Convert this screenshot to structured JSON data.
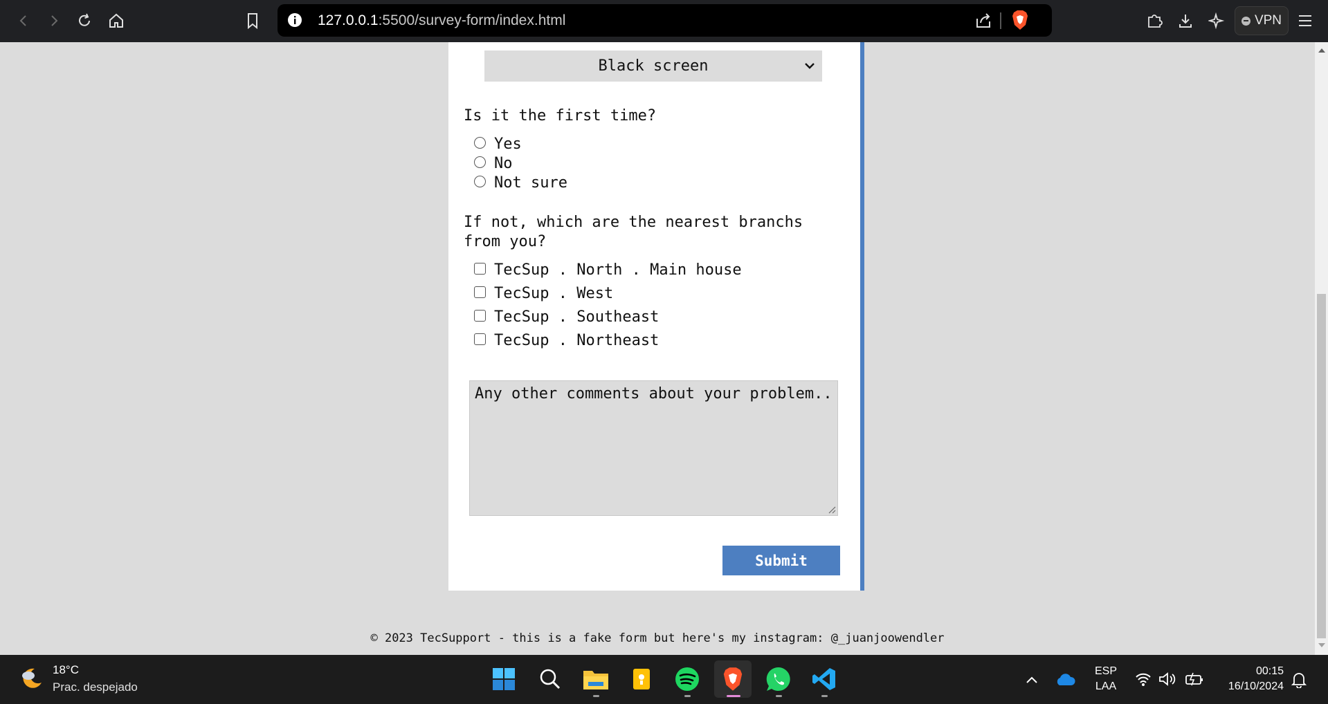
{
  "browser": {
    "url_host": "127.0.0.1",
    "url_path": ":5500/survey-form/index.html",
    "vpn_label": "VPN"
  },
  "form": {
    "select_value": "Black screen",
    "q_first_time": "Is it the first time?",
    "radio_options": [
      "Yes",
      "No",
      "Not sure"
    ],
    "q_branches": "If not, which are the nearest branchs from you?",
    "checkbox_options": [
      "TecSup . North . Main house",
      "TecSup . West",
      "TecSup . Southeast",
      "TecSup . Northeast"
    ],
    "comments_placeholder": "Any other comments about your problem..",
    "submit_label": "Submit"
  },
  "footer": {
    "text": "© 2023 TecSupport - this is a fake form but here's my instagram: @_juanjoowendler"
  },
  "taskbar": {
    "temperature": "18°C",
    "condition": "Prac. despejado",
    "lang_top": "ESP",
    "lang_bottom": "LAA",
    "time": "00:15",
    "date": "16/10/2024",
    "apps": [
      "windows-start",
      "search",
      "file-explorer",
      "notes",
      "spotify",
      "brave",
      "whatsapp",
      "vscode"
    ]
  },
  "colors": {
    "accent": "#4d7fc1",
    "page_bg": "#dcdcdc",
    "brave": "#fb542b",
    "spotify": "#1ed760",
    "whatsapp": "#25d366",
    "vscode": "#23a9f2"
  }
}
